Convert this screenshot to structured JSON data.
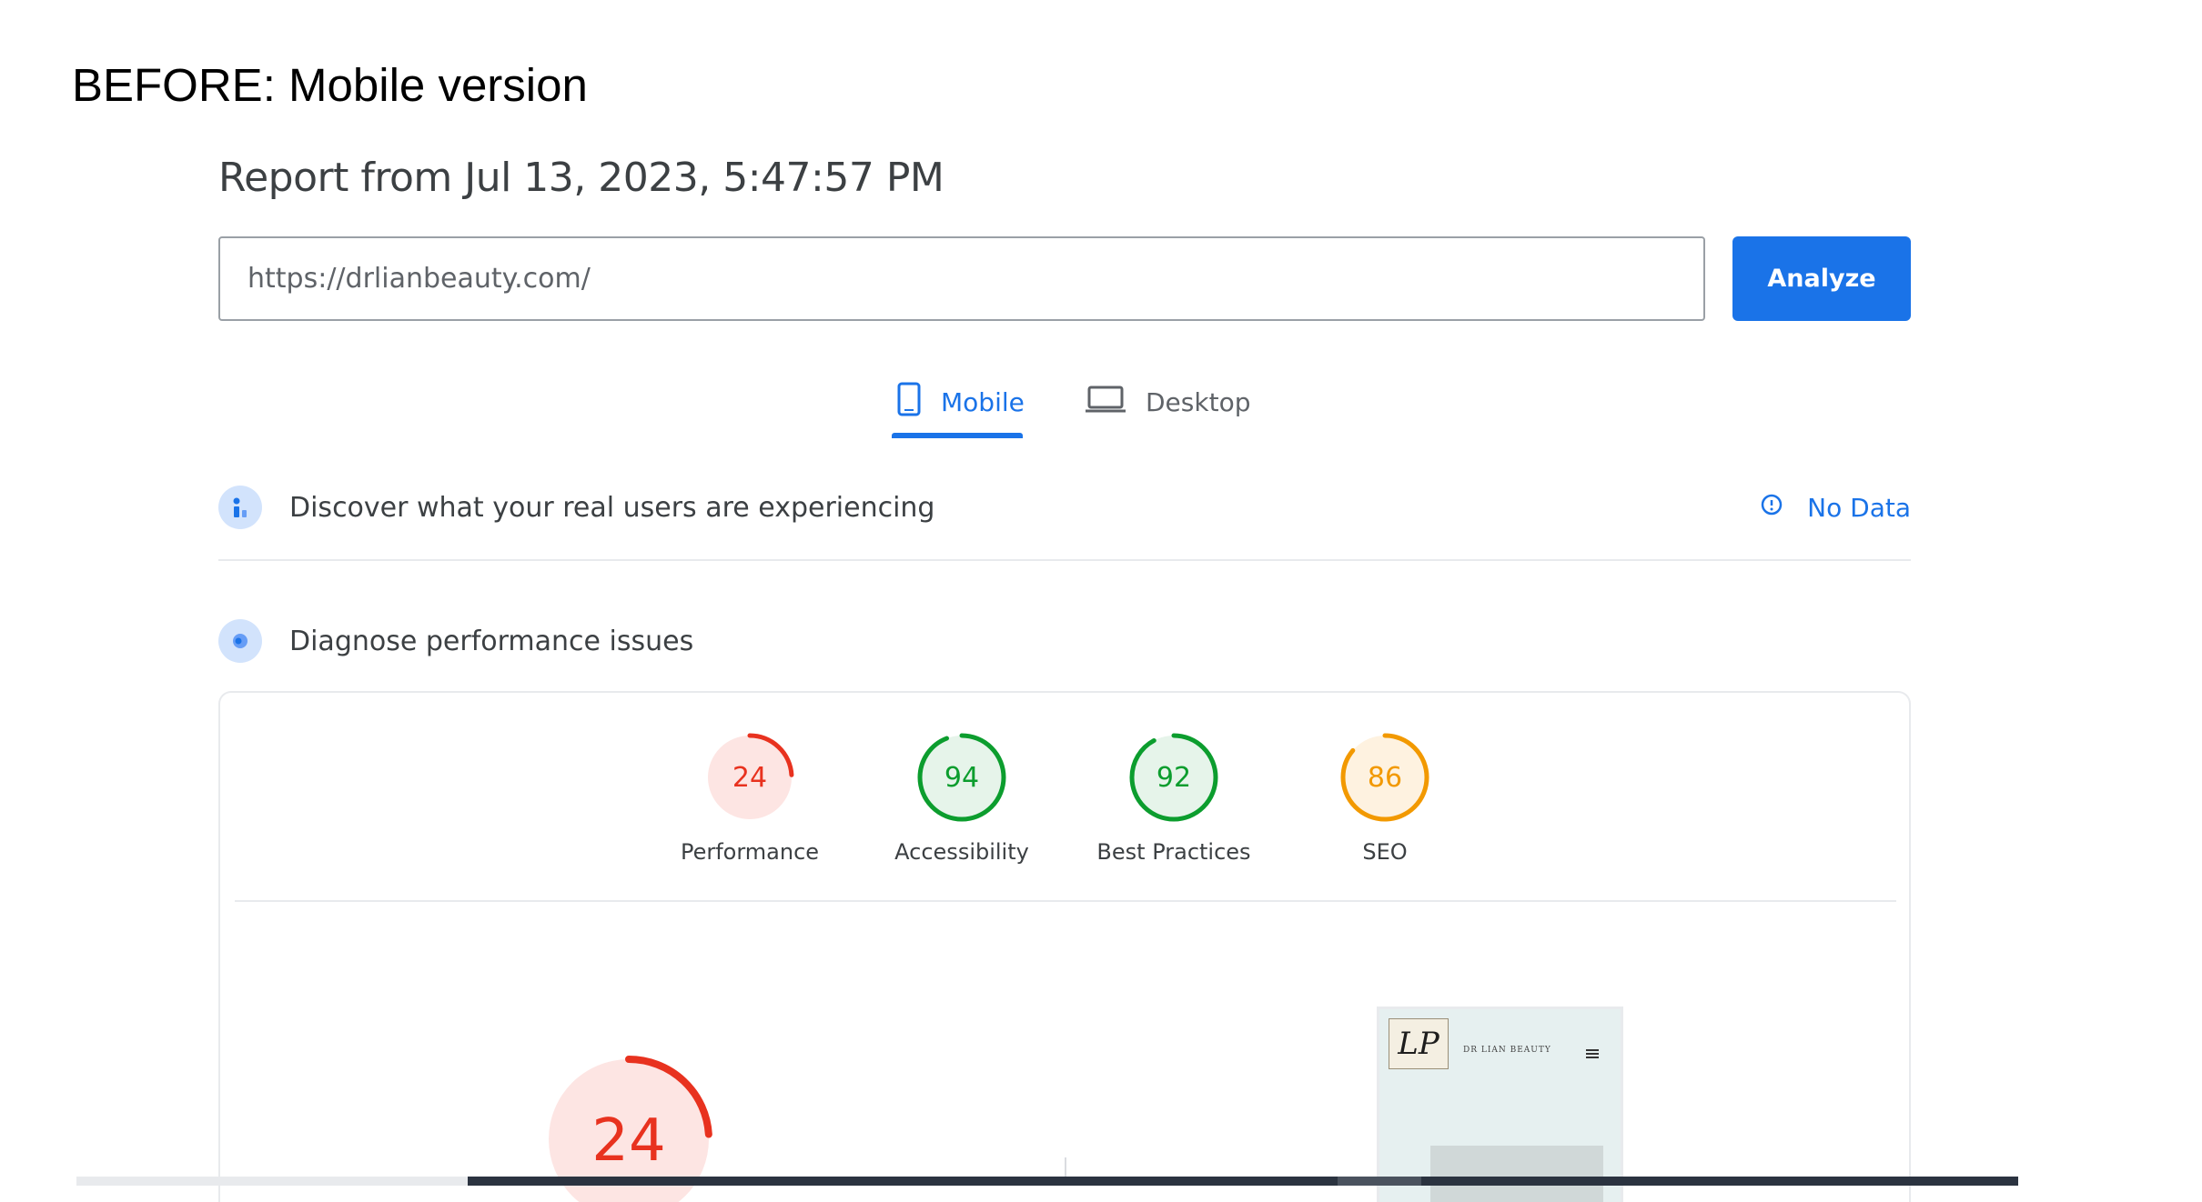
{
  "caption": "BEFORE: Mobile version",
  "report": {
    "title": "Report from Jul 13, 2023, 5:47:57 PM",
    "url_value": "https://drlianbeauty.com/",
    "analyze_label": "Analyze"
  },
  "tabs": [
    {
      "label": "Mobile",
      "icon": "phone-icon",
      "active": true
    },
    {
      "label": "Desktop",
      "icon": "laptop-icon",
      "active": false
    }
  ],
  "real_users": {
    "label": "Discover what your real users are experiencing",
    "status": "No Data"
  },
  "diagnose": {
    "label": "Diagnose performance issues"
  },
  "scores": [
    {
      "label": "Performance",
      "value": 24,
      "color": "#e8321f",
      "fill": "#fde5e3"
    },
    {
      "label": "Accessibility",
      "value": 94,
      "color": "#0c9d2e",
      "fill": "#e6f4ea"
    },
    {
      "label": "Best Practices",
      "value": 92,
      "color": "#0c9d2e",
      "fill": "#e6f4ea"
    },
    {
      "label": "SEO",
      "value": 86,
      "color": "#f29900",
      "fill": "#fef2e0"
    }
  ],
  "main_score": {
    "value": 24,
    "color": "#e8321f",
    "fill": "#fde5e3"
  },
  "thumbnail": {
    "logo_text": "LP",
    "brand_text": "DR LIAN BEAUTY"
  },
  "colors": {
    "accent": "#1a73e8"
  }
}
